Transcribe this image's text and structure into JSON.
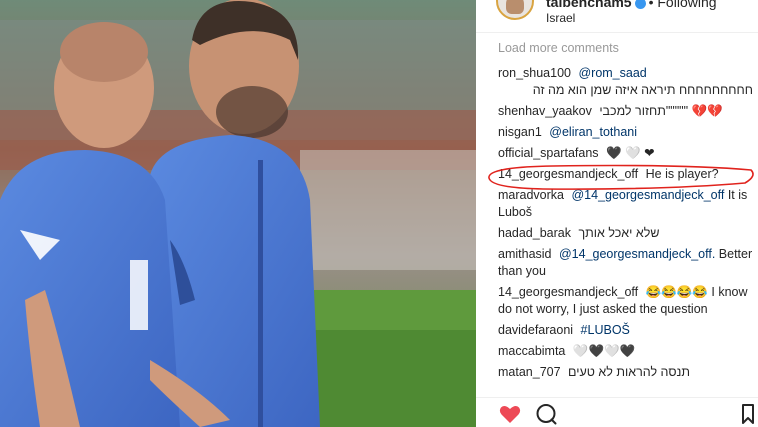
{
  "header": {
    "username": "talbencham5",
    "follow_status": "• Following",
    "location": "Israel"
  },
  "load_more": "Load more comments",
  "comments": [
    {
      "user": "ron_shua100",
      "mention": "@rom_saad",
      "text": "חחחחחחחחח תיראה איזה שמן הוא מה זה",
      "rtl": true
    },
    {
      "user": "shenhav_yaakov",
      "mention": "",
      "text": "תחזור למכבי\"\"\"\"\" 💔💔",
      "rtl": false
    },
    {
      "user": "nisgan1",
      "mention": "@eliran_tothani",
      "text": "",
      "rtl": false
    },
    {
      "user": "official_spartafans",
      "mention": "",
      "text": "🖤 🤍 ❤",
      "rtl": false
    },
    {
      "user": "14_georgesmandjeck_off",
      "mention": "",
      "text": "He is player?",
      "rtl": false
    },
    {
      "user": "maradvorka",
      "mention": "@14_georgesmandjeck_off",
      "text": "It is Luboš",
      "rtl": false
    },
    {
      "user": "hadad_barak",
      "mention": "",
      "text": "שלא יאכל אותך",
      "rtl": true
    },
    {
      "user": "amithasid",
      "mention": "@14_georgesmandjeck_off.",
      "text": "Better than you",
      "rtl": false
    },
    {
      "user": "14_georgesmandjeck_off",
      "mention": "",
      "text": "😂😂😂😂 I know do not worry, I just asked the question",
      "rtl": false
    },
    {
      "user": "davidefaraoni",
      "mention": "#LUBOŠ",
      "text": "",
      "rtl": false
    },
    {
      "user": "maccabimta",
      "mention": "",
      "text": "🤍🖤🤍🖤",
      "rtl": false
    },
    {
      "user": "matan_707",
      "mention": "",
      "text": "תנסה להראות לא טעים",
      "rtl": true
    }
  ],
  "icons": {
    "like": "heart-icon",
    "comment": "comment-icon",
    "save": "bookmark-icon"
  },
  "colors": {
    "like_red": "#ed4956",
    "mention_blue": "#003569",
    "highlight_red": "#e0231d",
    "jersey_blue": "#4a79d6"
  }
}
